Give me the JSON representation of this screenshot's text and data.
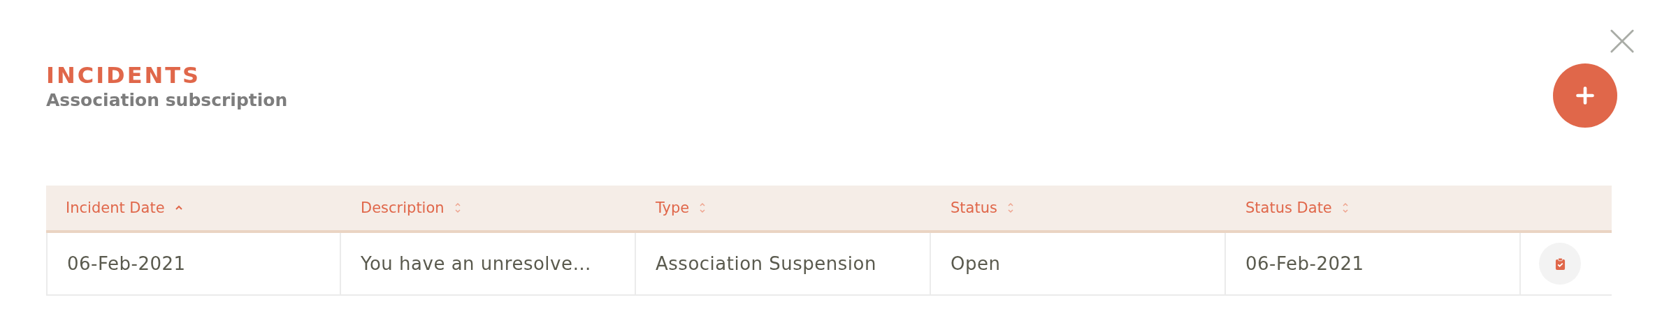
{
  "header": {
    "title": "INCIDENTS",
    "subtitle": "Association subscription"
  },
  "table": {
    "columns": [
      {
        "label": "Incident Date",
        "sorted": true
      },
      {
        "label": "Description",
        "sorted": false
      },
      {
        "label": "Type",
        "sorted": false
      },
      {
        "label": "Status",
        "sorted": false
      },
      {
        "label": "Status Date",
        "sorted": false
      }
    ],
    "rows": [
      {
        "cells": [
          "06-Feb-2021",
          "You have an unresolve…",
          "Association Suspension",
          "Open",
          "06-Feb-2021"
        ]
      }
    ]
  }
}
